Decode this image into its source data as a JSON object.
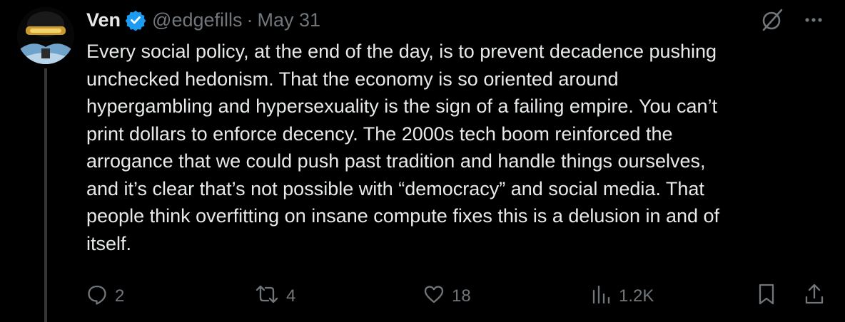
{
  "author": {
    "name": "Ven",
    "handle": "@edgefills",
    "separator": "·",
    "date": "May 31",
    "verified": true,
    "avatar_icon": "dark-helmet-avatar"
  },
  "top_icons": [
    "grok-icon",
    "more-icon"
  ],
  "tweet": {
    "text": "Every social policy, at the end of the day, is to prevent decadence pushing\nunchecked hedonism. That the economy is so oriented around\nhypergambling and hypersexuality is the sign of a failing empire. You can’t\nprint dollars to enforce decency. The 2000s tech boom reinforced the\narrogance that we could push past tradition and handle things ourselves,\nand it’s clear that’s not possible with “democracy” and social media. That\npeople think overfitting on insane compute fixes this is a delusion in and of\nitself."
  },
  "actions": {
    "replies": "2",
    "reposts": "4",
    "likes": "18",
    "views": "1.2K"
  },
  "colors": {
    "background": "#000000",
    "text": "#e7e9ea",
    "muted": "#71767b",
    "verified": "#1d9bf0",
    "thread_line": "#333639"
  }
}
